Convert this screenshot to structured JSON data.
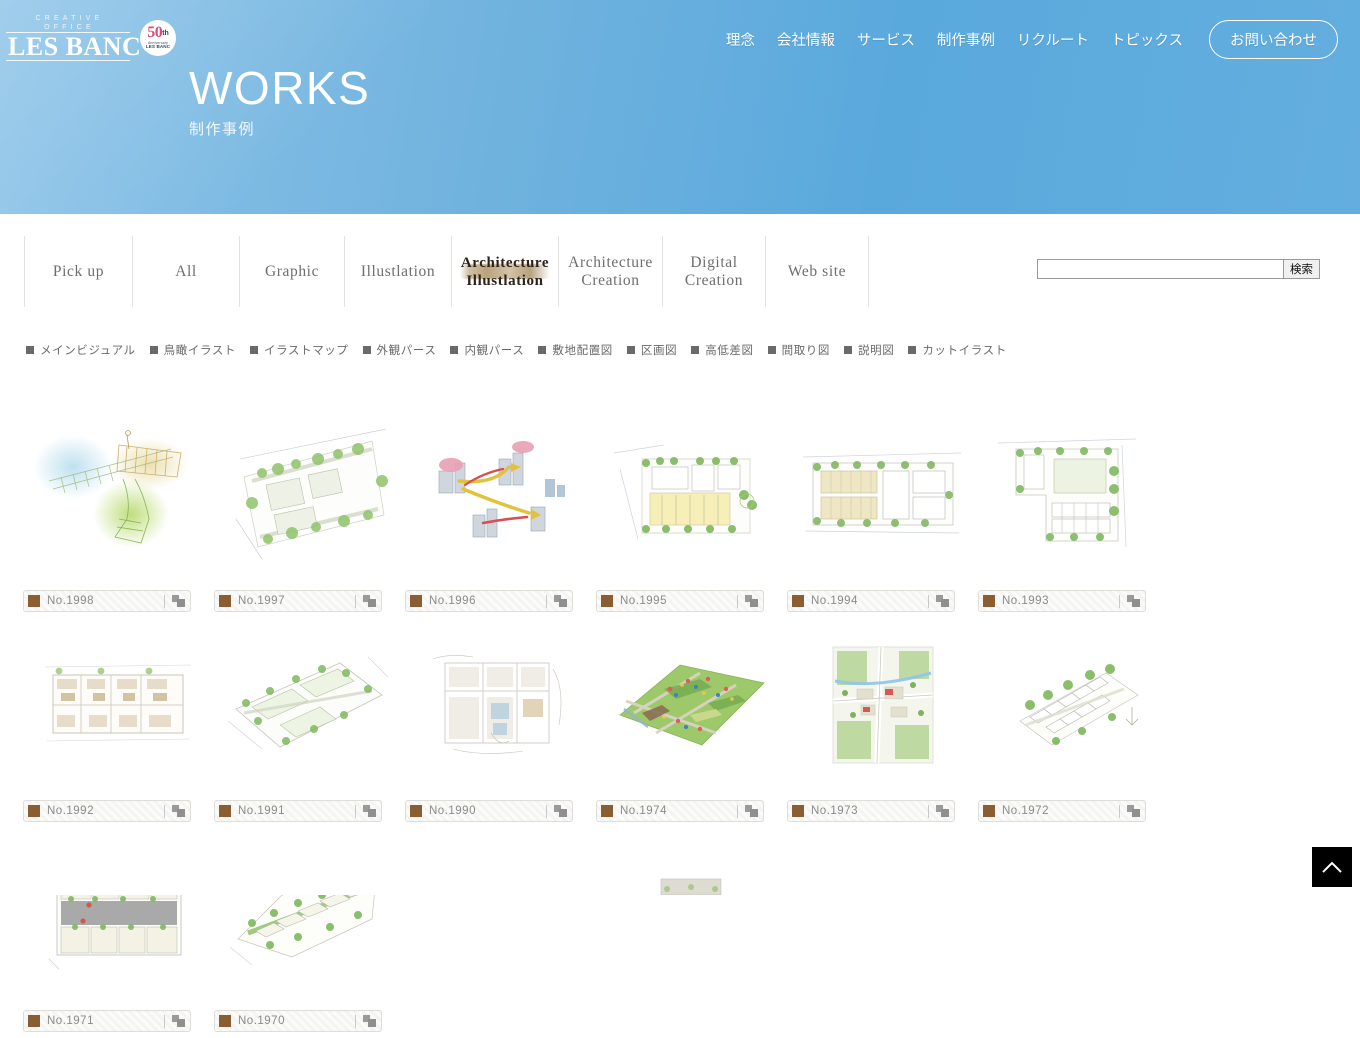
{
  "hero": {
    "brand": {
      "kicker": "CREATIVE OFFICE",
      "name": "LES BANC",
      "anniversary_number": "50",
      "anniversary_suffix": "th",
      "anniversary_sub": "Anniversary",
      "anniversary_brand": "LES BANC"
    },
    "nav": [
      {
        "label": "理念"
      },
      {
        "label": "会社情報"
      },
      {
        "label": "サービス"
      },
      {
        "label": "制作事例"
      },
      {
        "label": "リクルート"
      },
      {
        "label": "トピックス"
      }
    ],
    "contact_label": "お問い合わせ",
    "title": "WORKS",
    "subtitle": "制作事例",
    "accent_color": "#63aede"
  },
  "tabs": [
    {
      "label": "Pick up",
      "active": false
    },
    {
      "label": "All",
      "active": false
    },
    {
      "label": "Graphic",
      "active": false
    },
    {
      "label": "Illustlation",
      "active": false
    },
    {
      "label": "Architecture Illustlation",
      "line1": "Architecture",
      "line2": "Illustlation",
      "active": true
    },
    {
      "label": "Architecture Creation",
      "line1": "Architecture",
      "line2": "Creation",
      "active": false
    },
    {
      "label": "Digital Creation",
      "line1": "Digital",
      "line2": "Creation",
      "active": false
    },
    {
      "label": "Web site",
      "active": false
    }
  ],
  "search": {
    "value": "",
    "placeholder": "",
    "button_label": "検索"
  },
  "categories": [
    {
      "label": "メインビジュアル"
    },
    {
      "label": "鳥瞰イラスト"
    },
    {
      "label": "イラストマップ"
    },
    {
      "label": "外観パース"
    },
    {
      "label": "内観パース"
    },
    {
      "label": "敷地配置図"
    },
    {
      "label": "区画図"
    },
    {
      "label": "高低差図"
    },
    {
      "label": "間取り図"
    },
    {
      "label": "説明図"
    },
    {
      "label": "カットイラスト"
    }
  ],
  "works": [
    {
      "no": "No.1998",
      "kind": "watercolor-aerial"
    },
    {
      "no": "No.1997",
      "kind": "site-plan-green"
    },
    {
      "no": "No.1996",
      "kind": "diagram-route"
    },
    {
      "no": "No.1995",
      "kind": "site-plan-yellow"
    },
    {
      "no": "No.1994",
      "kind": "site-plan-wide"
    },
    {
      "no": "No.1993",
      "kind": "site-plan-tall"
    },
    {
      "no": "No.1992",
      "kind": "floor-plan"
    },
    {
      "no": "No.1991",
      "kind": "site-plan-angled"
    },
    {
      "no": "No.1990",
      "kind": "sketch-plan"
    },
    {
      "no": "No.1974",
      "kind": "illust-map-iso"
    },
    {
      "no": "No.1973",
      "kind": "illust-map-road"
    },
    {
      "no": "No.1972",
      "kind": "row-house-plan"
    },
    {
      "no": "No.1971",
      "kind": "block-plan-grey"
    },
    {
      "no": "No.1970",
      "kind": "site-plan-long"
    }
  ],
  "back_to_top": {
    "icon": "chevron-up-icon",
    "label": ""
  }
}
